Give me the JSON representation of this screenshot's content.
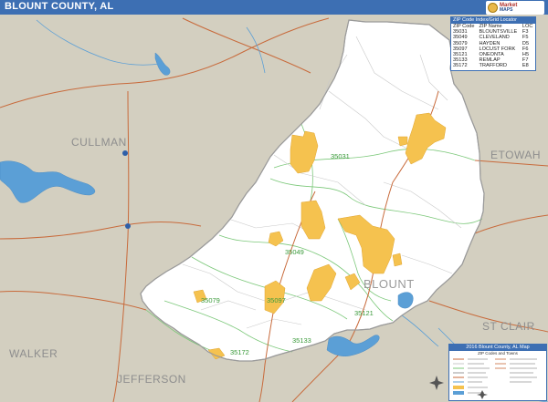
{
  "title": "BLOUNT COUNTY, AL",
  "logo": {
    "line1": "Market",
    "line2": "MAPS"
  },
  "county_labels": {
    "cullman": "CULLMAN",
    "etowah": "ETOWAH",
    "blount": "BLOUNT",
    "st_clair": "ST CLAIR",
    "walker": "WALKER",
    "jefferson": "JEFFERSON"
  },
  "zip_labels": [
    "35031",
    "35049",
    "35079",
    "35097",
    "35121",
    "35133",
    "35172"
  ],
  "zip_index": {
    "title": "ZIP Code Index/Grid Locator",
    "headers": [
      "ZIP Code",
      "ZIP Name",
      "LOC"
    ],
    "rows": [
      [
        "35031",
        "BLOUNTSVILLE",
        "F3"
      ],
      [
        "35049",
        "CLEVELAND",
        "F5"
      ],
      [
        "35079",
        "HAYDEN",
        "D5"
      ],
      [
        "35097",
        "LOCUST FORK",
        "F6"
      ],
      [
        "35121",
        "ONEONTA",
        "H5"
      ],
      [
        "35133",
        "REMLAP",
        "F7"
      ],
      [
        "35172",
        "TRAFFORD",
        "E8"
      ]
    ]
  },
  "legend": {
    "title": "2016 Blount County, AL Map",
    "subtitle": "ZIP Codes and Towns"
  },
  "colors": {
    "outside": "#d3cfc0",
    "county": "#ffffff",
    "towns": "#f5c24f",
    "water": "#5b9fd6",
    "roads_major": "#c86a3b",
    "zip_lines": "#7cc87a",
    "title_bar": "#3d6fb3"
  }
}
